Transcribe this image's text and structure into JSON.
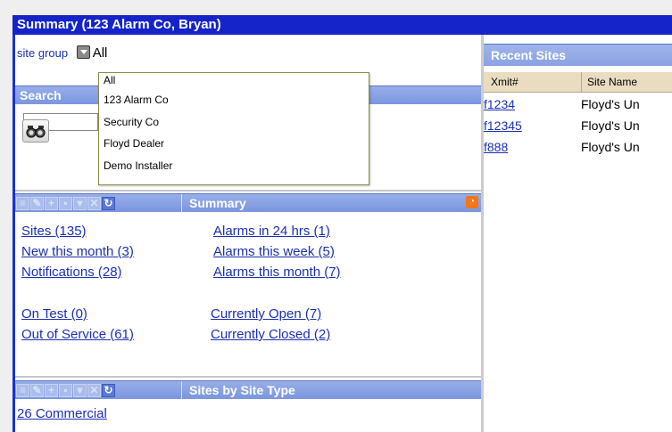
{
  "window": {
    "title": "Summary (123 Alarm Co, Bryan)"
  },
  "site_group": {
    "label": "site group",
    "selected": "All",
    "options": [
      "All",
      "123 Alarm Co",
      "Security Co",
      "Floyd Dealer",
      "Demo Installer"
    ]
  },
  "search": {
    "header": "Search"
  },
  "summary_panel": {
    "title": "Summary",
    "links": {
      "sites": "Sites (135)",
      "new_this_month": "New this month (3)",
      "notifications": "Notifications (28)",
      "alarms_24hrs": "Alarms in 24 hrs (1)",
      "alarms_week": "Alarms this week (5)",
      "alarms_month": "Alarms this month (7)",
      "on_test": "On Test (0)",
      "out_of_service": "Out of Service (61)",
      "currently_open": "Currently Open (7)",
      "currently_closed": "Currently Closed (2)"
    }
  },
  "site_type_panel": {
    "title": "Sites by Site Type",
    "first_item": "26 Commercial"
  },
  "recent_sites": {
    "header": "Recent Sites",
    "columns": [
      "Xmit#",
      "Site Name"
    ],
    "rows": [
      {
        "xmit": "f1234",
        "name": "Floyd's Un"
      },
      {
        "xmit": "f12345",
        "name": "Floyd's Un"
      },
      {
        "xmit": "f888",
        "name": "Floyd's Un"
      }
    ]
  },
  "toolbar_icons": [
    "list-icon",
    "edit-icon",
    "add-icon",
    "save-icon",
    "filter-icon",
    "delete-icon",
    "refresh-icon"
  ],
  "colors": {
    "title_bar": "#1524c8",
    "section_header": "#8aa2e2",
    "link": "#1a2fb4",
    "rss": "#f07818"
  }
}
